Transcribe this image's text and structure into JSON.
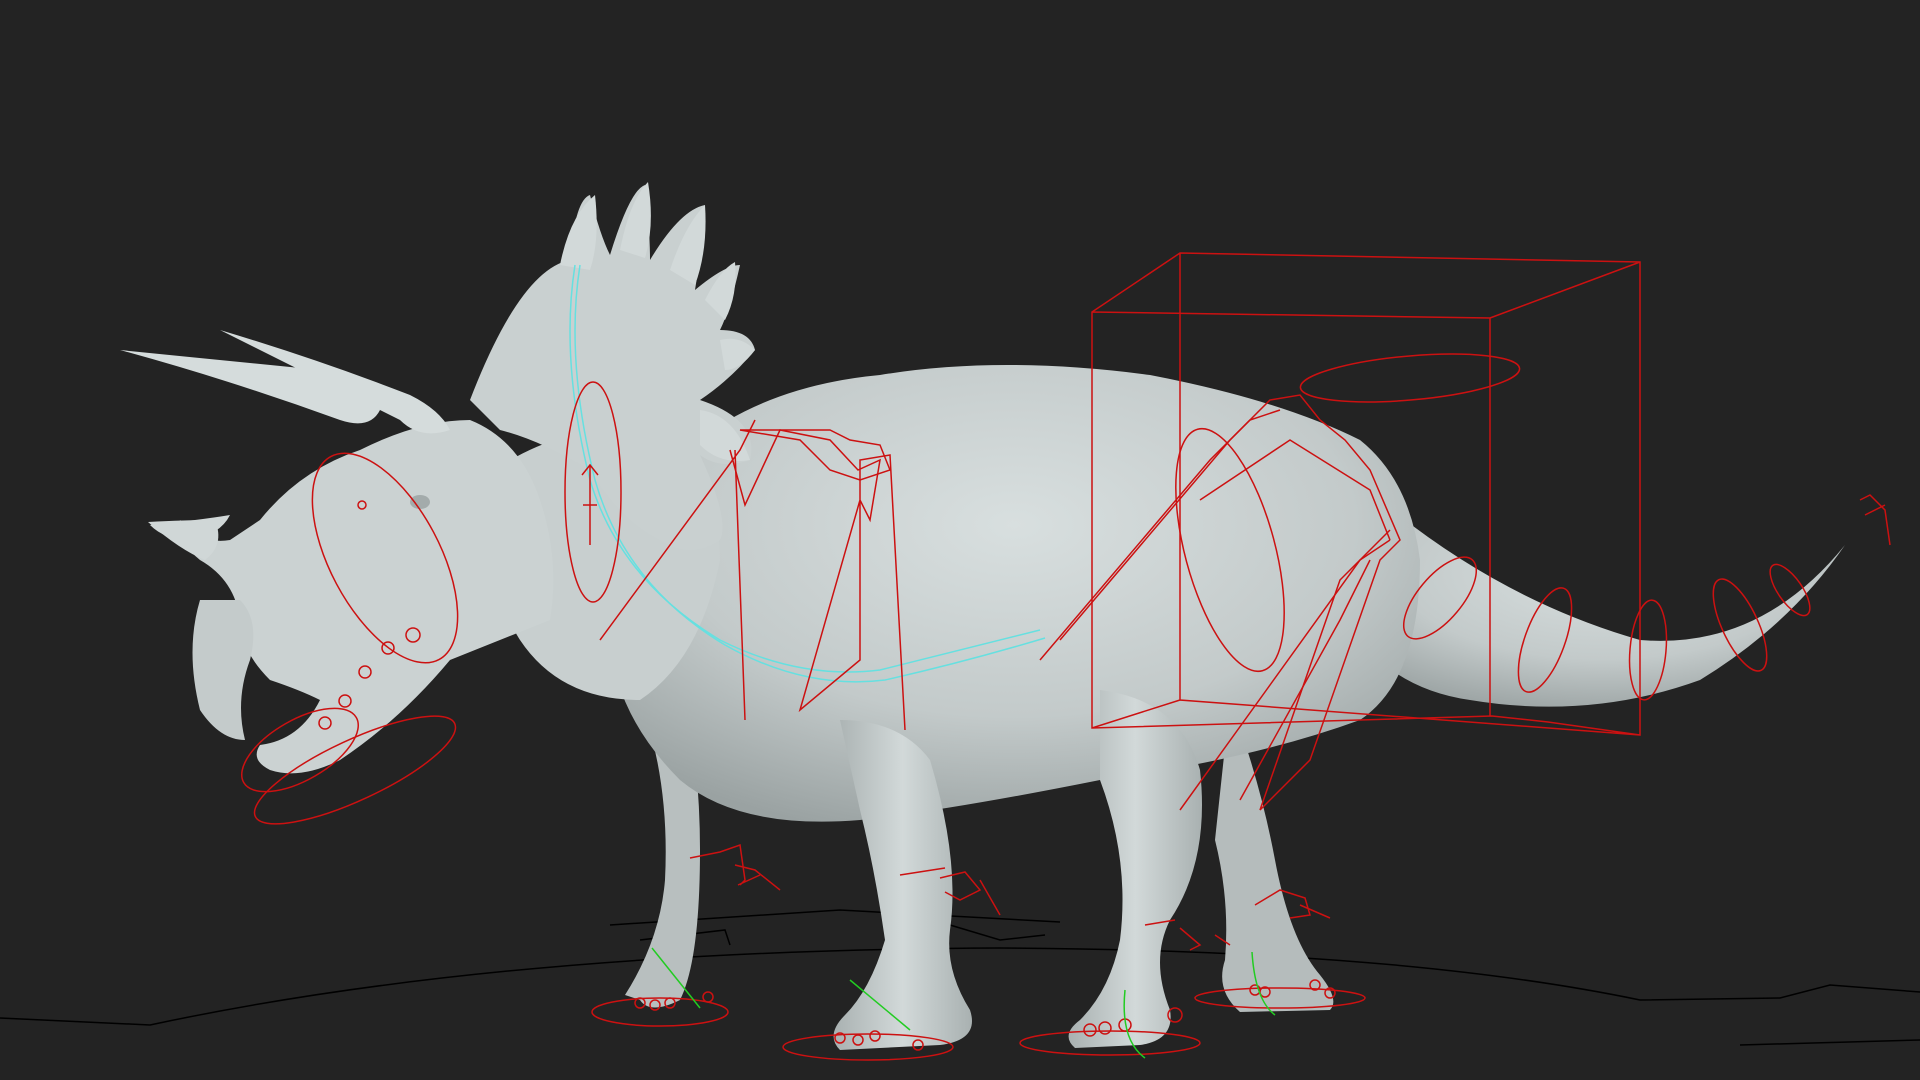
{
  "viewport": {
    "background_color": "#232323",
    "subject": "triceratops-model",
    "mesh_color": "#c6cdcd",
    "rig_control_color": "#cc1111",
    "ik_handle_color": "#22cc22",
    "spline_curve_color": "#66e0e0",
    "ground_curve_color": "#000000"
  }
}
